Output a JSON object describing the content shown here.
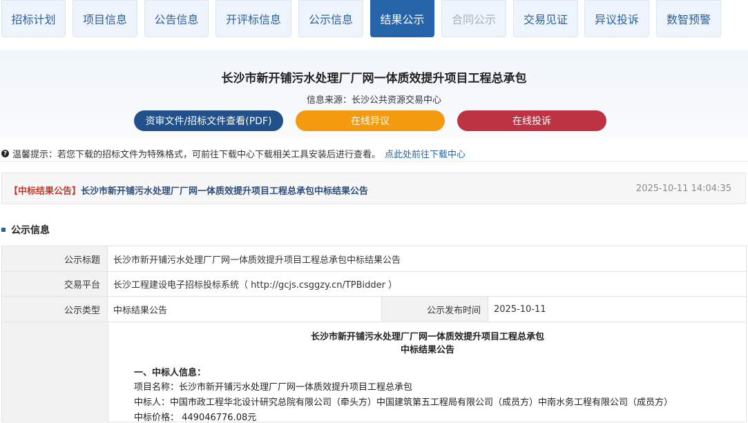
{
  "tabs": [
    {
      "label": "招标计划",
      "state": "normal"
    },
    {
      "label": "项目信息",
      "state": "normal"
    },
    {
      "label": "公告信息",
      "state": "normal"
    },
    {
      "label": "开评标信息",
      "state": "normal"
    },
    {
      "label": "公示信息",
      "state": "normal"
    },
    {
      "label": "结果公示",
      "state": "active"
    },
    {
      "label": "合同公示",
      "state": "disabled"
    },
    {
      "label": "交易见证",
      "state": "normal"
    },
    {
      "label": "异议投诉",
      "state": "normal"
    },
    {
      "label": "数智预警",
      "state": "normal"
    }
  ],
  "header": {
    "title": "长沙市新开铺污水处理厂厂网一体质效提升项目工程总承包",
    "source": "信息来源：长沙公共资源交易中心"
  },
  "actions": {
    "docs_label": "资审文件/招标文件查看(PDF)",
    "objection_label": "在线异议",
    "complaint_label": "在线投诉"
  },
  "colors": {
    "primary": "#2564a9",
    "docs": "#21508a",
    "objection": "#f39a0e",
    "complaint": "#bd3343"
  },
  "tip": {
    "text": "温馨提示：若您下载的招标文件为特殊格式，可前往下载中心下载相关工具安装后进行查看。",
    "link": "点此处前往下载中心",
    "icon": "question-icon"
  },
  "announcement": {
    "tag": "【中标结果公告】",
    "title": "长沙市新开铺污水处理厂厂网一体质效提升项目工程总承包中标结果公告",
    "datetime": "2025-10-11 14:04:35"
  },
  "section": {
    "title": "公示信息"
  },
  "info": {
    "title_label": "公示标题",
    "title_value": "长沙市新开铺污水处理厂厂网一体质效提升项目工程总承包中标结果公告",
    "platform_label": "交易平台",
    "platform_value": "长沙工程建设电子招标投标系统（ http://gcjs.csggzy.cn/TPBidder ）",
    "type_label": "公示类型",
    "type_value": "中标结果公告",
    "date_label": "公示发布时间",
    "date_value": "2025-10-11"
  },
  "notice": {
    "heading1": "长沙市新开铺污水处理厂厂网一体质效提升项目工程总承包",
    "heading2": "中标结果公告",
    "section1": "一、中标人信息：",
    "project": "项目名称：长沙市新开铺污水处理厂厂网一体质效提升项目工程总承包",
    "winner": "中标人：中国市政工程华北设计研究总院有限公司（牵头方）中国建筑第五工程局有限公司（成员方）中南水务工程有限公司（成员方）",
    "price": "中标价格：  449046776.08元"
  }
}
